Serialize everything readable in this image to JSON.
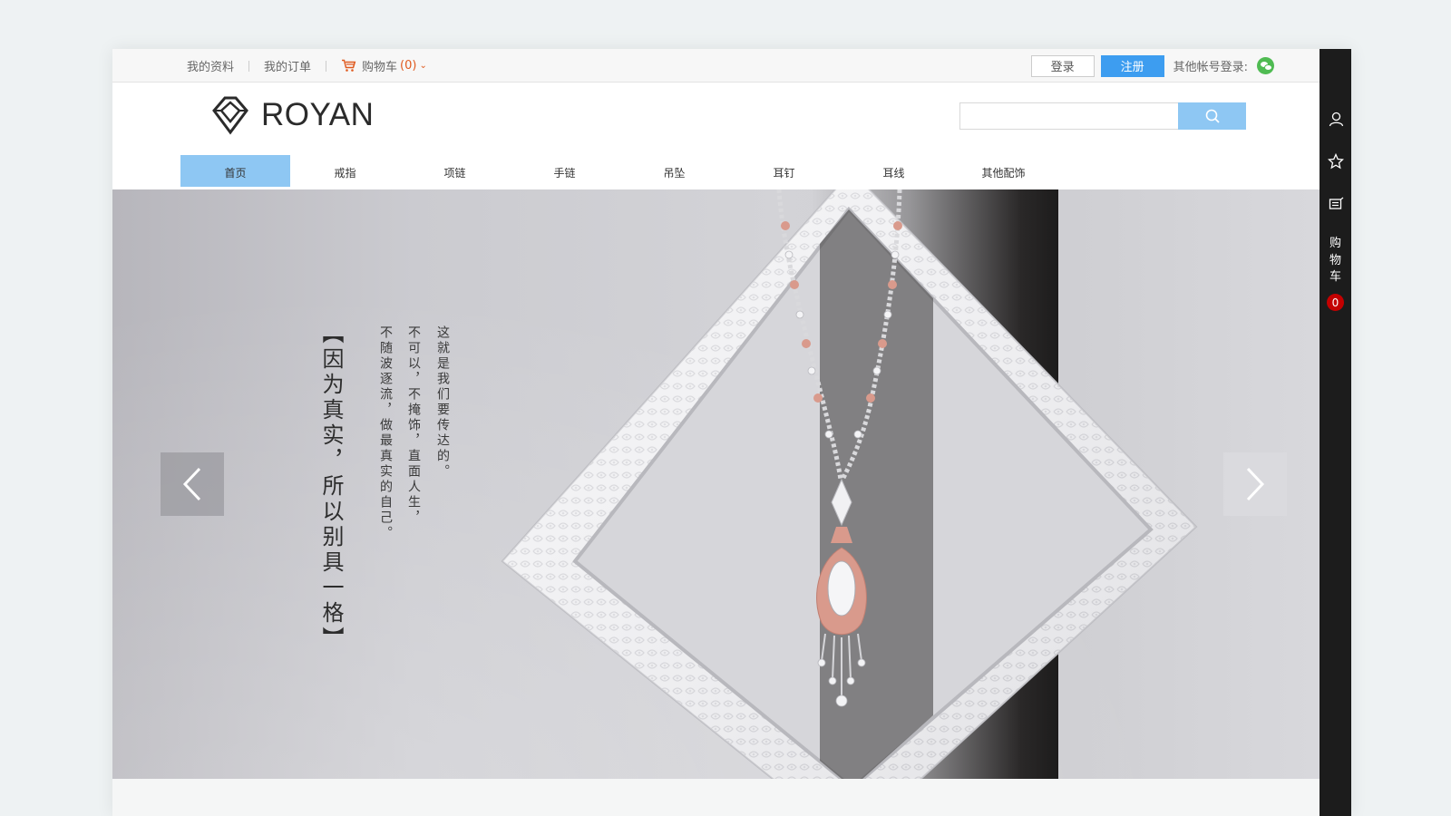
{
  "topbar": {
    "my_profile": "我的资料",
    "my_orders": "我的订单",
    "cart_label": "购物车",
    "cart_count": "(0)",
    "login": "登录",
    "register": "注册",
    "other_login": "其他帐号登录:",
    "accent_color": "#3d9df0",
    "cart_color": "#e05a1f"
  },
  "header": {
    "brand": "ROYAN",
    "search_placeholder": ""
  },
  "nav": {
    "items": [
      {
        "label": "首页",
        "active": true
      },
      {
        "label": "戒指"
      },
      {
        "label": "项链"
      },
      {
        "label": "手链"
      },
      {
        "label": "吊坠"
      },
      {
        "label": "耳钉"
      },
      {
        "label": "耳线"
      },
      {
        "label": "其他配饰"
      }
    ],
    "active_color": "#8ec7f3"
  },
  "banner": {
    "headline": "【因为真实，所以别具一格】",
    "line1": "这就是我们要传达的。",
    "line2": "不可以，不掩饰，直面人生，",
    "line3": "不随波逐流，做最真实的自己。"
  },
  "sidebar": {
    "cart_label": "购\n物\n车",
    "cart_badge": "0",
    "icons": [
      "user-icon",
      "star-icon",
      "message-icon"
    ]
  }
}
